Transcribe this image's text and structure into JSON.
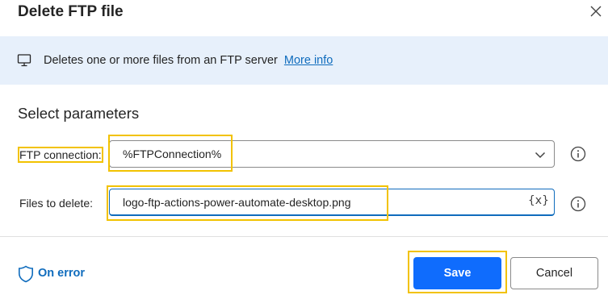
{
  "dialog": {
    "title": "Delete FTP file",
    "close_icon": "close-icon"
  },
  "info": {
    "icon": "monitor-icon",
    "text": "Deletes one or more files from an FTP server",
    "link": "More info"
  },
  "params": {
    "section_title": "Select parameters",
    "ftp_connection": {
      "label": "FTP connection:",
      "value": "%FTPConnection%",
      "icon": "chevron-down-icon"
    },
    "files_to_delete": {
      "label": "Files to delete:",
      "value": "logo-ftp-actions-power-automate-desktop.png",
      "variable_button": "{x}"
    },
    "help_icon": "info-circle-icon"
  },
  "footer": {
    "on_error": "On error",
    "on_error_icon": "shield-icon",
    "save": "Save",
    "cancel": "Cancel"
  },
  "colors": {
    "accent": "#0f6cbd",
    "primary_button": "#0f6cfd",
    "highlight": "#f2c200",
    "info_bar": "#e7f0fb"
  }
}
